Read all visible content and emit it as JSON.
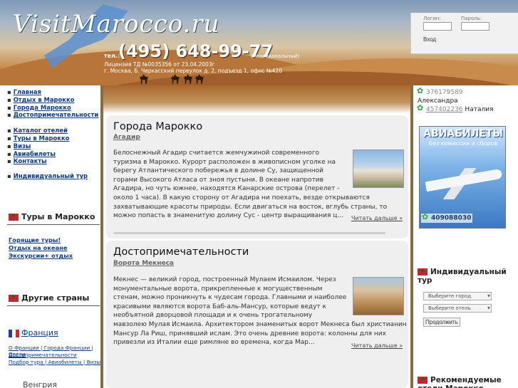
{
  "header": {
    "logo": "VisitMarocco.ru",
    "phone_prefix": "тел.:",
    "phone": "(495) 648-99-77",
    "phone_note": "(многоканальный)",
    "license": "Лицензия ТД №0035356 от 23.04.2003г",
    "address": "г. Москва, Б. Черкасский переулок д. 2, подъезд 1, офис №420"
  },
  "login": {
    "login_label": "Логин:",
    "password_label": "Пароль:",
    "button": "Вход"
  },
  "nav": [
    "Главная",
    "Отдых в Марокко",
    "Города Марокко",
    "Достопримечательности",
    "Каталог отелей",
    "Туры в Марокко",
    "Визы",
    "Авиабилеты",
    "Контакты",
    "",
    "Индивидуальный тур"
  ],
  "left": {
    "tours_title": "Туры в Марокко",
    "tour_links": [
      "Горящие туры!",
      "Отдых на океане",
      " Экскурсии+ отдых"
    ],
    "other_title": "Другие страны",
    "france": "Франция",
    "france_links_1": "О Франции | Города Франции | Отели",
    "france_links_2": "Достопримечательности",
    "france_links_3": "Подбор тура | Авиабилеты | Визы",
    "next_country": "Венгрия"
  },
  "articles": [
    {
      "heading": "Города Марокко",
      "subheading": "Агадир",
      "lines": [
        "Белоснежный Агадир считается жемчужиной современного",
        "туризма в Марокко. Курорт расположен в живописном уголке на",
        "берегу Атлантического побережья в долине Су, защищенной",
        "горами Высокого Атласа от зноя пустыни. В океане напротив",
        "Агадира, но чуть южнее, находятся Канарские острова (перелет -",
        "около 1 часа). В какую сторону от Агадира ни поехать, везде открываются",
        "захватывающие красоты природы. Если двигаться на восток, вглубь страны, то",
        "можно попасть в знаменитую долину Сус - центр выращивания ц..."
      ],
      "more": "Читать дальше »"
    },
    {
      "heading": "Достопримечательности",
      "subheading": "Ворота Мекнеса",
      "lines": [
        "Мекнес — великий город, построенный Мулаем Исмаилом. Через",
        "монументальные ворота, прикрепленные к могущественным",
        "стенам, можно проникнуть к чудесам города. Главными и наиболее",
        "красивыми являются ворота Баб-аль-Мансур, которые ведут к",
        "необъятной дворцовой площади и к очень трогательному",
        "мавзолею Мулая Исмаила. Архитектором знаменитых ворот Мекнеса был христианин",
        "Мансур Ла Риш, принявший ислам. Это очень древние ворота: колонны для них",
        "привезли из Италии еще римляне во времена, когда Мар..."
      ],
      "more": "Читать дальше »"
    }
  ],
  "right": {
    "icq1": "376179589",
    "name1": "Александра",
    "icq2": "457402236",
    "name2": "Наталия",
    "avia_title": "АВИАБИЛЕТЫ",
    "avia_sub": "Без комиссии и сборов",
    "avia_phone": "409088030",
    "indiv_title": "Индивидуальный тур",
    "select_city": "Выберите город",
    "select_hotel": "Выберите отель",
    "continue": "Продолжить",
    "recommended": "Рекомендуемые отели Марокко"
  },
  "colors": {
    "link": "#0b3a8a",
    "panel": "#efefef",
    "sidebar_edge": "#8a6a3f"
  }
}
